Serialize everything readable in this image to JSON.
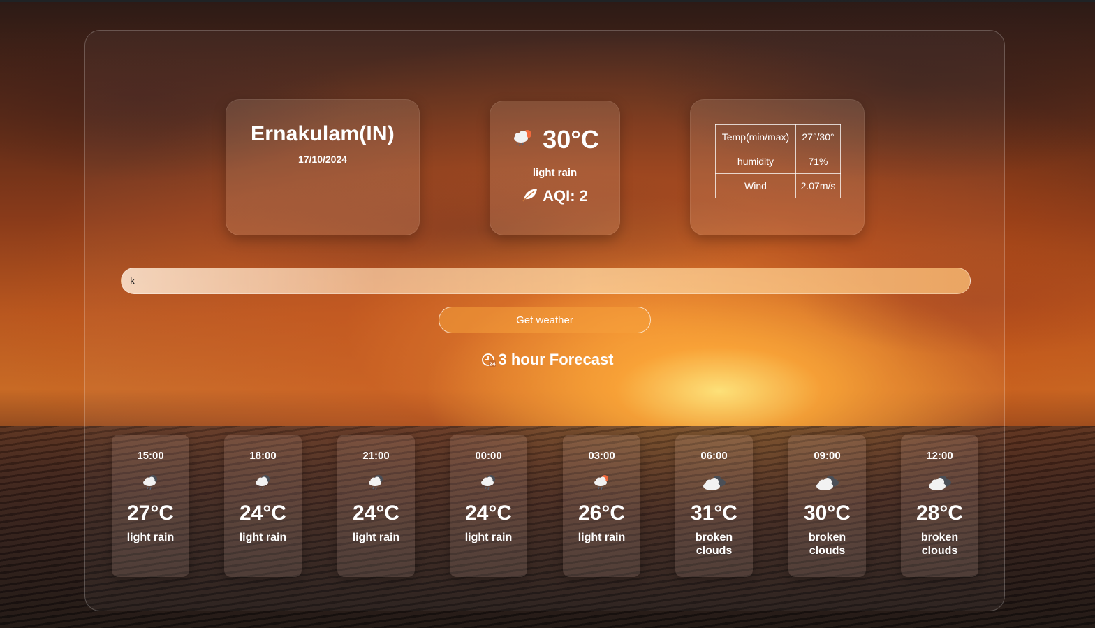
{
  "current": {
    "city": "Ernakulam(IN)",
    "date": "17/10/2024",
    "temp": "30°C",
    "description": "light rain",
    "aqi": "AQI: 2",
    "icon": "cloud-rain-sun-icon"
  },
  "stats": [
    {
      "label": "Temp(min/max)",
      "value": "27°/30°"
    },
    {
      "label": "humidity",
      "value": "71%"
    },
    {
      "label": "Wind",
      "value": "2.07m/s"
    }
  ],
  "search": {
    "value": "k",
    "button_label": "Get weather"
  },
  "forecast": {
    "title": "3 hour Forecast",
    "items": [
      {
        "time": "15:00",
        "temp": "27°C",
        "desc": "light rain",
        "icon": "cloud-rain-icon"
      },
      {
        "time": "18:00",
        "temp": "24°C",
        "desc": "light rain",
        "icon": "cloud-rain-icon"
      },
      {
        "time": "21:00",
        "temp": "24°C",
        "desc": "light rain",
        "icon": "cloud-rain-icon"
      },
      {
        "time": "00:00",
        "temp": "24°C",
        "desc": "light rain",
        "icon": "cloud-rain-icon"
      },
      {
        "time": "03:00",
        "temp": "26°C",
        "desc": "light rain",
        "icon": "cloud-rain-sun-icon"
      },
      {
        "time": "06:00",
        "temp": "31°C",
        "desc": "broken clouds",
        "icon": "broken-clouds-icon"
      },
      {
        "time": "09:00",
        "temp": "30°C",
        "desc": "broken clouds",
        "icon": "broken-clouds-icon"
      },
      {
        "time": "12:00",
        "temp": "28°C",
        "desc": "broken clouds",
        "icon": "broken-clouds-icon"
      }
    ]
  },
  "colors": {
    "text": "#ffffff",
    "sun_accent": "#f26a3d",
    "cloud_front": "#f2f2f2",
    "cloud_back": "#4a4f57"
  }
}
